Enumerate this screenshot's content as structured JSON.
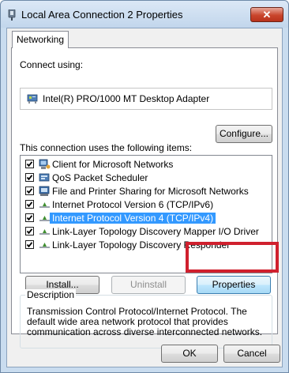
{
  "window": {
    "title": "Local Area Connection 2 Properties",
    "close_label": "✕"
  },
  "tabs": [
    {
      "label": "Networking"
    }
  ],
  "connect": {
    "label": "Connect using:",
    "adapter": "Intel(R) PRO/1000 MT Desktop Adapter",
    "configure_label": "Configure..."
  },
  "items": {
    "label": "This connection uses the following items:",
    "list": [
      {
        "label": "Client for Microsoft Networks",
        "checked": true,
        "icon": "client-icon"
      },
      {
        "label": "QoS Packet Scheduler",
        "checked": true,
        "icon": "qos-icon"
      },
      {
        "label": "File and Printer Sharing for Microsoft Networks",
        "checked": true,
        "icon": "file-printer-sharing-icon"
      },
      {
        "label": "Internet Protocol Version 6 (TCP/IPv6)",
        "checked": true,
        "icon": "protocol-icon"
      },
      {
        "label": "Internet Protocol Version 4 (TCP/IPv4)",
        "checked": true,
        "icon": "protocol-icon",
        "selected": true
      },
      {
        "label": "Link-Layer Topology Discovery Mapper I/O Driver",
        "checked": true,
        "icon": "protocol-icon"
      },
      {
        "label": "Link-Layer Topology Discovery Responder",
        "checked": true,
        "icon": "protocol-icon"
      }
    ]
  },
  "actions": {
    "install": "Install...",
    "uninstall": "Uninstall",
    "properties": "Properties"
  },
  "description": {
    "legend": "Description",
    "text": "Transmission Control Protocol/Internet Protocol. The default wide area network protocol that provides communication across diverse interconnected networks."
  },
  "footer": {
    "ok": "OK",
    "cancel": "Cancel"
  },
  "colors": {
    "highlight": "#d0202e",
    "selection": "#3399ff"
  }
}
